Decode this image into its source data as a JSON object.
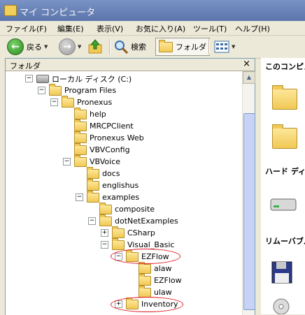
{
  "window": {
    "title": "マイ コンピュータ"
  },
  "menu": [
    "ファイル(F)",
    "編集(E)",
    "表示(V)",
    "お気に入り(A)",
    "ツール(T)",
    "ヘルプ(H)"
  ],
  "toolbar": {
    "back_label": "戻る",
    "search_label": "検索",
    "folders_label": "フォルダ"
  },
  "folder_pane": {
    "title": "フォルダ",
    "close": "×"
  },
  "tree": [
    {
      "label": "ローカル ディスク (C:)",
      "expander": "minus",
      "icon": "drive-icon"
    },
    {
      "label": "Program Files",
      "expander": "minus"
    },
    {
      "label": "Pronexus",
      "expander": "minus"
    },
    {
      "label": "help",
      "expander": "none"
    },
    {
      "label": "MRCPClient",
      "expander": "none"
    },
    {
      "label": "Pronexus Web",
      "expander": "none"
    },
    {
      "label": "VBVConfig",
      "expander": "none"
    },
    {
      "label": "VBVoice",
      "expander": "minus"
    },
    {
      "label": "docs",
      "expander": "none"
    },
    {
      "label": "englishus",
      "expander": "none"
    },
    {
      "label": "examples",
      "expander": "minus"
    },
    {
      "label": "composite",
      "expander": "none"
    },
    {
      "label": "dotNetExamples",
      "expander": "minus"
    },
    {
      "label": "CSharp",
      "expander": "plus"
    },
    {
      "label": "Visual_Basic",
      "expander": "minus"
    },
    {
      "label": "EZFlow",
      "expander": "minus",
      "highlighted": true
    },
    {
      "label": "alaw",
      "expander": "none"
    },
    {
      "label": "EZFlow",
      "expander": "none"
    },
    {
      "label": "ulaw",
      "expander": "none"
    },
    {
      "label": "Inventory",
      "expander": "plus",
      "highlighted": true
    }
  ],
  "right_pane": {
    "section1": "このコンピュ",
    "section2": "ハード ディ",
    "section3": "リムーバブル"
  },
  "colors": {
    "highlight_ellipse": "#e3141d",
    "titlebar": "#6b83b8"
  }
}
